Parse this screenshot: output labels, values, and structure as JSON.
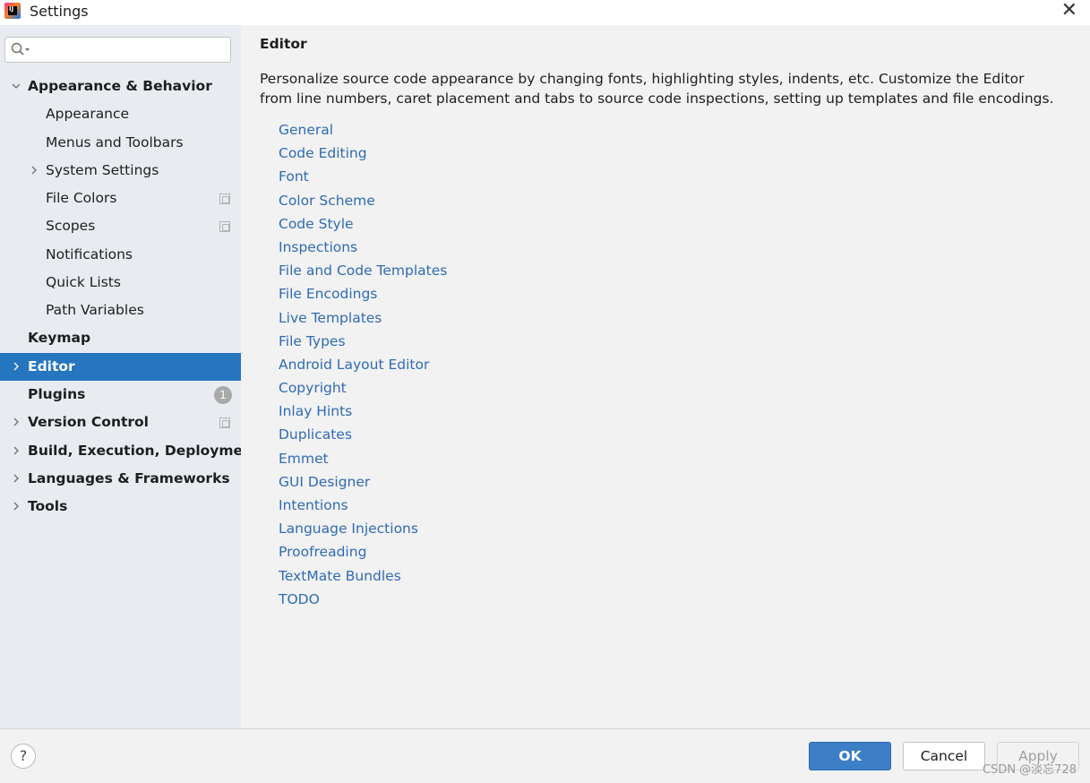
{
  "window": {
    "title": "Settings",
    "app_icon_text": "IJ"
  },
  "search": {
    "placeholder": "",
    "value": ""
  },
  "sidebar": {
    "items": [
      {
        "label": "Appearance & Behavior",
        "bold": true,
        "chevron": "down"
      },
      {
        "label": "Appearance"
      },
      {
        "label": "Menus and Toolbars"
      },
      {
        "label": "System Settings",
        "chevron": "right"
      },
      {
        "label": "File Colors",
        "badge": "copy"
      },
      {
        "label": "Scopes",
        "badge": "copy"
      },
      {
        "label": "Notifications"
      },
      {
        "label": "Quick Lists"
      },
      {
        "label": "Path Variables"
      },
      {
        "label": "Keymap",
        "bold": true
      },
      {
        "label": "Editor",
        "bold": true,
        "chevron": "right",
        "selected": true
      },
      {
        "label": "Plugins",
        "bold": true,
        "badge_count": "1"
      },
      {
        "label": "Version Control",
        "bold": true,
        "chevron": "right",
        "badge": "copy"
      },
      {
        "label": "Build, Execution, Deployment",
        "bold": true,
        "chevron": "right"
      },
      {
        "label": "Languages & Frameworks",
        "bold": true,
        "chevron": "right"
      },
      {
        "label": "Tools",
        "bold": true,
        "chevron": "right"
      }
    ]
  },
  "main": {
    "title": "Editor",
    "description": "Personalize source code appearance by changing fonts, highlighting styles, indents, etc. Customize the Editor from line numbers, caret placement and tabs to source code inspections, setting up templates and file encodings.",
    "links": [
      "General",
      "Code Editing",
      "Font",
      "Color Scheme",
      "Code Style",
      "Inspections",
      "File and Code Templates",
      "File Encodings",
      "Live Templates",
      "File Types",
      "Android Layout Editor",
      "Copyright",
      "Inlay Hints",
      "Duplicates",
      "Emmet",
      "GUI Designer",
      "Intentions",
      "Language Injections",
      "Proofreading",
      "TextMate Bundles",
      "TODO"
    ]
  },
  "footer": {
    "help_label": "?",
    "ok_label": "OK",
    "cancel_label": "Cancel",
    "apply_label": "Apply",
    "watermark": "CSDN @淡忘728"
  },
  "colors": {
    "selection": "#2675bf",
    "link": "#2f6bb5",
    "ok_button": "#3d7fc6"
  }
}
